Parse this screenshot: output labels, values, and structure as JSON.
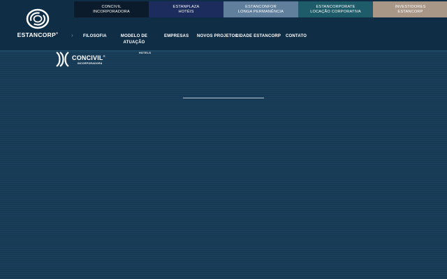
{
  "colors": {
    "header_bg": "#0f2d45",
    "page_bg": "#163a55",
    "tab_concivil": "#0c1b2b",
    "tab_estanplaza": "#1c2c5c",
    "tab_estanconfor": "#5f7f9d",
    "tab_estancorporate": "#1e5c6a",
    "tab_investidores": "#a89787"
  },
  "header": {
    "logo_text": "ESTANCORP",
    "logo_mark": "®",
    "top_tabs": [
      {
        "line1": "CONCIVIL",
        "line2": "INCORPORADORA"
      },
      {
        "line1": "ESTANPLAZA",
        "line2": "HOTÉIS"
      },
      {
        "line1": "ESTANCONFOR",
        "line2": "LONGA PERMANÊNCIA"
      },
      {
        "line1": "ESTANCORPORATE",
        "line2": "LOCAÇÃO CORPORATIVA"
      },
      {
        "line1": "INVESTIDORES",
        "line2": "ESTANCORP"
      }
    ],
    "nav": {
      "chevron": "›",
      "filosofia": "FILOSOFIA",
      "modelo_line1": "MODELO DE",
      "modelo_line2": "ATUAÇÃO",
      "empresas": "EMPRESAS",
      "novos_projetos": "NOVOS PROJETOS",
      "cidade": "CIDADE ESTANCORP",
      "contato": "CONTATO"
    }
  },
  "brand": {
    "name": "CONCIVIL",
    "mark": "®",
    "sub": "INCORPORADORA",
    "hotels_label": "HOTELS"
  }
}
